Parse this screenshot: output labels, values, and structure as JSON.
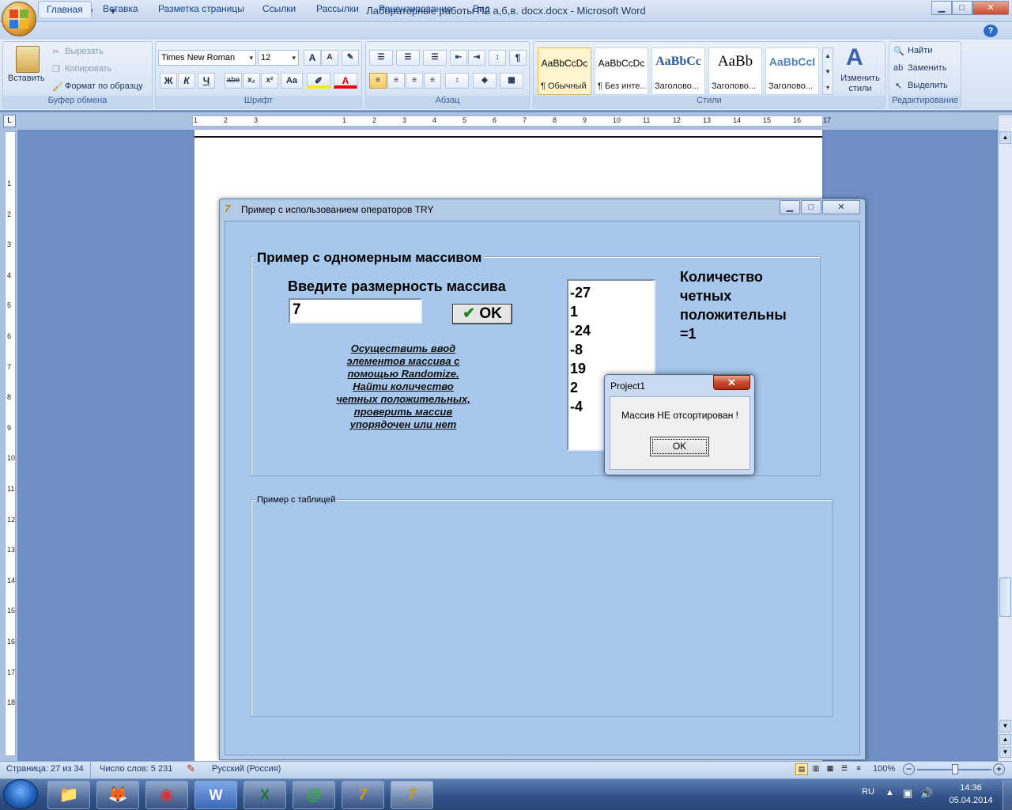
{
  "word": {
    "title": "Лабораторные работы П2 а,б,в. docx.docx - Microsoft Word",
    "window_buttons": {
      "minimize": "▁",
      "maximize": "□",
      "close": "✕"
    },
    "tabs": [
      "Главная",
      "Вставка",
      "Разметка страницы",
      "Ссылки",
      "Рассылки",
      "Рецензирование",
      "Вид"
    ],
    "active_tab": "Главная",
    "clipboard": {
      "paste": "Вставить",
      "cut": "Вырезать",
      "copy": "Копировать",
      "format_painter": "Формат по образцу",
      "label": "Буфер обмена"
    },
    "font": {
      "name": "Times New Roman",
      "size": "12",
      "bold": "Ж",
      "italic": "К",
      "underline": "Ч",
      "strike": "abe",
      "subscript": "x₂",
      "superscript": "x²",
      "case": "Aa",
      "label": "Шрифт"
    },
    "paragraph": {
      "label": "Абзац",
      "pilcrow": "¶"
    },
    "styles": {
      "label": "Стили",
      "items": [
        {
          "sample": "AaBbCcDc",
          "name": "¶ Обычный"
        },
        {
          "sample": "AaBbCcDc",
          "name": "¶ Без инте..."
        },
        {
          "sample": "AaBbCc",
          "name": "Заголово..."
        },
        {
          "sample": "AaBb",
          "name": "Заголово..."
        },
        {
          "sample": "AaBbCcI",
          "name": "Заголово..."
        }
      ],
      "change": "Изменить стили"
    },
    "editing": {
      "find": "Найти",
      "replace": "Заменить",
      "select": "Выделить",
      "label": "Редактирование"
    },
    "ruler_ticks": [
      "3",
      "2",
      "1",
      "1",
      "2",
      "3",
      "4",
      "5",
      "6",
      "7",
      "8",
      "9",
      "10",
      "11",
      "12",
      "13",
      "14",
      "15",
      "16",
      "17"
    ],
    "vruler_ticks": [
      "1",
      "2",
      "3",
      "4",
      "5",
      "6",
      "7",
      "8",
      "9",
      "10",
      "11",
      "12",
      "13",
      "14",
      "15",
      "16",
      "17",
      "18"
    ],
    "status": {
      "page": "Страница: 27 из 34",
      "words": "Число слов: 5 231",
      "language": "Русский (Россия)",
      "zoom": "100%"
    }
  },
  "app": {
    "title": "Пример с использованием операторов TRY",
    "group1_title": "Пример с одномерным массивом",
    "prompt": "Введите размерность массива",
    "size_value": "7",
    "ok_label": "OK",
    "task_lines": [
      "Осуществить ввод",
      "элементов массива с",
      "помощью Randomize.",
      "Найти количество",
      "четных положительных,",
      "проверить массив",
      "упорядочен или нет"
    ],
    "list_values": [
      "-27",
      "1",
      "-24",
      "-8",
      "19",
      "2",
      "-4"
    ],
    "result_lines": [
      "Количество",
      "четных",
      "положительны",
      "=1"
    ],
    "group2_title": "Пример с таблицей"
  },
  "dialog": {
    "title": "Project1",
    "message": "Массив НЕ отсортирован !",
    "ok": "OK",
    "close": "✕"
  },
  "taskbar": {
    "lang": "RU",
    "time": "14:36",
    "date": "05.04.2014"
  }
}
